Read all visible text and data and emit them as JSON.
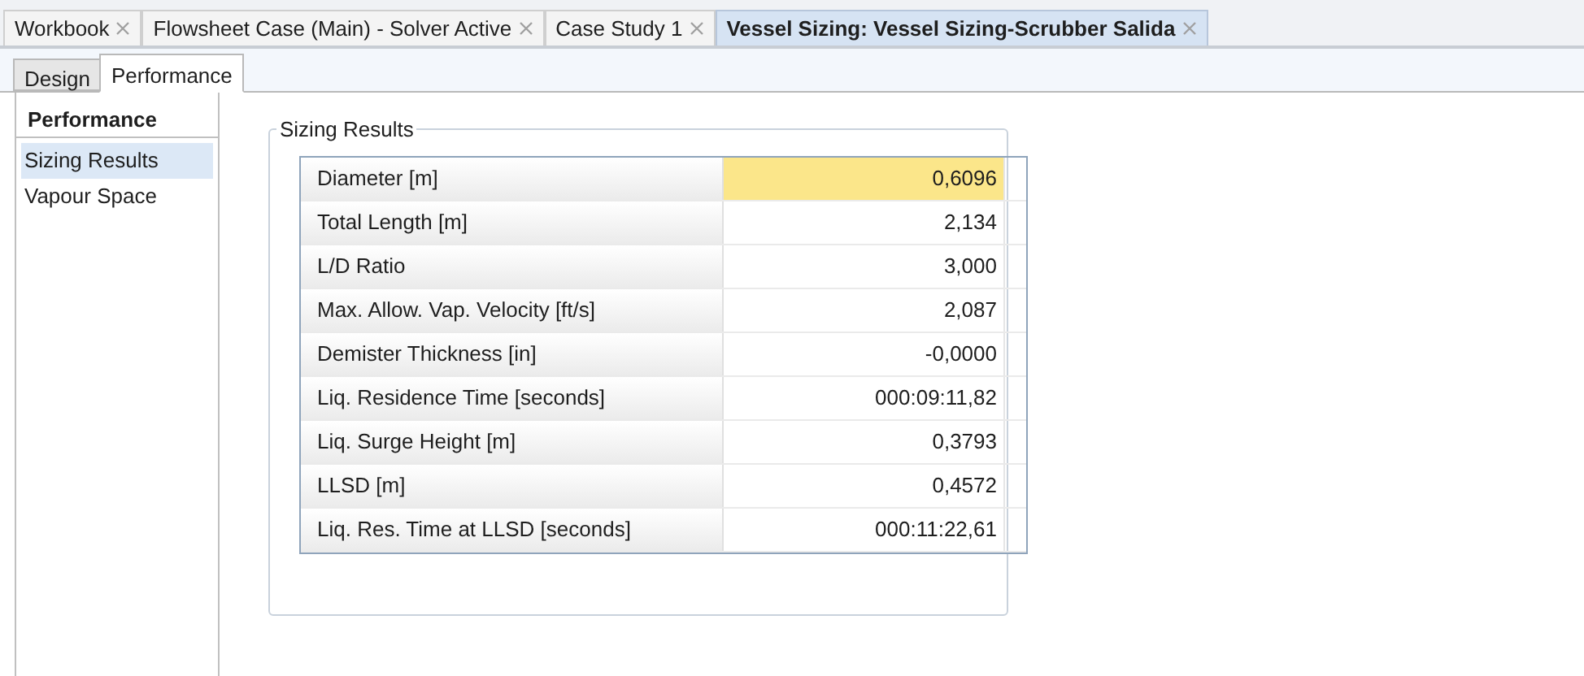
{
  "document_tabs": [
    {
      "label": "Workbook",
      "selected": false
    },
    {
      "label": "Flowsheet Case (Main) - Solver Active",
      "selected": false
    },
    {
      "label": "Case Study 1",
      "selected": false
    },
    {
      "label": "Vessel Sizing: Vessel Sizing-Scrubber Salida",
      "selected": true
    }
  ],
  "tabs": [
    {
      "label": "Design",
      "selected": false
    },
    {
      "label": "Performance",
      "selected": true
    }
  ],
  "sidebar": {
    "title": "Performance",
    "items": [
      {
        "label": "Sizing Results",
        "selected": true
      },
      {
        "label": "Vapour Space",
        "selected": false
      }
    ]
  },
  "group": {
    "title": "Sizing Results",
    "rows": [
      {
        "label": "Diameter [m]",
        "value": "0,6096",
        "highlighted": true
      },
      {
        "label": "Total Length [m]",
        "value": "2,134",
        "highlighted": false
      },
      {
        "label": "L/D Ratio",
        "value": "3,000",
        "highlighted": false
      },
      {
        "label": "Max. Allow. Vap. Velocity [ft/s]",
        "value": "2,087",
        "highlighted": false
      },
      {
        "label": "Demister Thickness [in]",
        "value": "-0,0000",
        "highlighted": false
      },
      {
        "label": "Liq. Residence Time [seconds]",
        "value": "000:09:11,82",
        "highlighted": false
      },
      {
        "label": "Liq. Surge Height [m]",
        "value": "0,3793",
        "highlighted": false
      },
      {
        "label": "LLSD [m]",
        "value": "0,4572",
        "highlighted": false
      },
      {
        "label": "Liq. Res. Time at LLSD [seconds]",
        "value": "000:11:22,61",
        "highlighted": false
      }
    ]
  }
}
